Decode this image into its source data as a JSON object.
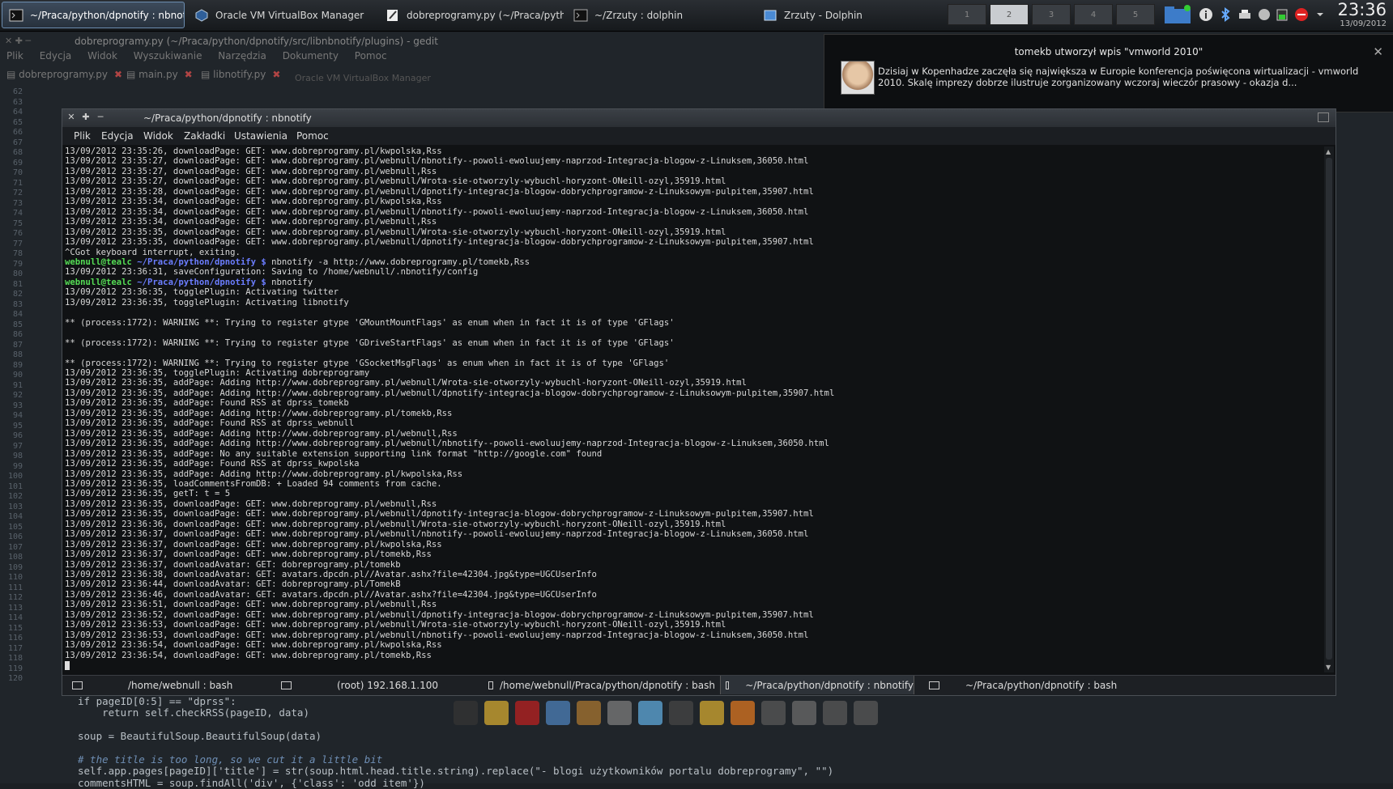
{
  "taskbar": {
    "tasks": [
      {
        "label": "~/Praca/python/dpnotify : nbnotify",
        "icon": "terminal-icon",
        "active": true
      },
      {
        "label": "Oracle VM VirtualBox Manager",
        "icon": "virtualbox-icon",
        "active": false
      },
      {
        "label": "dobreprogramy.py (~/Praca/python",
        "icon": "text-editor-icon",
        "active": false
      },
      {
        "label": "~/Zrzuty : dolphin",
        "icon": "terminal-icon",
        "active": false
      },
      {
        "label": "Zrzuty - Dolphin",
        "icon": "file-manager-icon",
        "active": false
      }
    ],
    "pager": [
      "1",
      "2",
      "3",
      "4",
      "5"
    ],
    "pager_current": 2,
    "clock_time": "23:36",
    "clock_date": "13/09/2012"
  },
  "gedit": {
    "title": "dobreprogramy.py (~/Praca/python/dpnotify/src/libnbnotify/plugins) - gedit",
    "menu": [
      "Plik",
      "Edycja",
      "Widok",
      "Wyszukiwanie",
      "Narzędzia",
      "Dokumenty",
      "Pomoc"
    ],
    "tabs": [
      "dobreprogramy.py",
      "main.py",
      "libnotify.py"
    ],
    "ghost_title": "Oracle VM VirtualBox Manager",
    "line_numbers": [
      "62",
      "63",
      "64",
      "65",
      "66",
      "67",
      "68",
      "69",
      "70",
      "71",
      "72",
      "73",
      "74",
      "75",
      "76",
      "77",
      "78",
      "79",
      "80",
      "81",
      "82",
      "83",
      "84",
      "85",
      "86",
      "87",
      "88",
      "89",
      "90",
      "91",
      "92",
      "93",
      "94",
      "95",
      "96",
      "97",
      "98",
      "99",
      "100",
      "101",
      "102",
      "103",
      "104",
      "105",
      "106",
      "107",
      "108",
      "109",
      "110",
      "111",
      "112",
      "113",
      "114",
      "115",
      "116",
      "117",
      "118",
      "119",
      "120"
    ],
    "code_lines": [
      "if pageID[0:5] == \"dprss\":",
      "    return self.checkRSS(pageID, data)",
      "",
      "soup = BeautifulSoup.BeautifulSoup(data)",
      "",
      "# the title is too long, so we cut it a little bit",
      "self.app.pages[pageID]['title'] = str(soup.html.head.title.string).replace(\"- blogi użytkowników portalu dobreprogramy\", \"\")",
      "commentsHTML = soup.findAll('div', {'class': 'odd item'})"
    ]
  },
  "notification": {
    "title": "tomekb utworzył wpis \"vmworld 2010\"",
    "body": "Dzisiaj w Kopenhadze zaczęła się największa w Europie konferencja poświęcona wirtualizacji - vmworld 2010. Skalę imprezy dobrze ilustruje zorganizowany wczoraj wieczór prasowy - okazja d..."
  },
  "konsole": {
    "title": "~/Praca/python/dpnotify : nbnotify",
    "menu": [
      "Plik",
      "Edycja",
      "Widok",
      "Zakładki",
      "Ustawienia",
      "Pomoc"
    ],
    "prompt_user": "webnull@tealc",
    "prompt_path": "~/Praca/python/dpnotify $",
    "lines": [
      {
        "t": "13/09/2012 23:35:26, downloadPage: GET: www.dobreprogramy.pl/kwpolska,Rss"
      },
      {
        "t": "13/09/2012 23:35:27, downloadPage: GET: www.dobreprogramy.pl/webnull/nbnotify--powoli-ewoluujemy-naprzod-Integracja-blogow-z-Linuksem,36050.html"
      },
      {
        "t": "13/09/2012 23:35:27, downloadPage: GET: www.dobreprogramy.pl/webnull,Rss"
      },
      {
        "t": "13/09/2012 23:35:27, downloadPage: GET: www.dobreprogramy.pl/webnull/Wrota-sie-otworzyly-wybuchl-horyzont-ONeill-ozyl,35919.html"
      },
      {
        "t": "13/09/2012 23:35:28, downloadPage: GET: www.dobreprogramy.pl/webnull/dpnotify-integracja-blogow-dobrychprogramow-z-Linuksowym-pulpitem,35907.html"
      },
      {
        "t": "13/09/2012 23:35:34, downloadPage: GET: www.dobreprogramy.pl/kwpolska,Rss"
      },
      {
        "t": "13/09/2012 23:35:34, downloadPage: GET: www.dobreprogramy.pl/webnull/nbnotify--powoli-ewoluujemy-naprzod-Integracja-blogow-z-Linuksem,36050.html"
      },
      {
        "t": "13/09/2012 23:35:34, downloadPage: GET: www.dobreprogramy.pl/webnull,Rss"
      },
      {
        "t": "13/09/2012 23:35:35, downloadPage: GET: www.dobreprogramy.pl/webnull/Wrota-sie-otworzyly-wybuchl-horyzont-ONeill-ozyl,35919.html"
      },
      {
        "t": "13/09/2012 23:35:35, downloadPage: GET: www.dobreprogramy.pl/webnull/dpnotify-integracja-blogow-dobrychprogramow-z-Linuksowym-pulpitem,35907.html"
      },
      {
        "t": "^CGot keyboard interrupt, exiting."
      },
      {
        "p": true,
        "t": " nbnotify -a http://www.dobreprogramy.pl/tomekb,Rss"
      },
      {
        "t": "13/09/2012 23:36:31, saveConfiguration: Saving to /home/webnull/.nbnotify/config"
      },
      {
        "p": true,
        "t": " nbnotify"
      },
      {
        "t": "13/09/2012 23:36:35, togglePlugin: Activating twitter"
      },
      {
        "t": "13/09/2012 23:36:35, togglePlugin: Activating libnotify"
      },
      {
        "t": ""
      },
      {
        "t": "** (process:1772): WARNING **: Trying to register gtype 'GMountMountFlags' as enum when in fact it is of type 'GFlags'"
      },
      {
        "t": ""
      },
      {
        "t": "** (process:1772): WARNING **: Trying to register gtype 'GDriveStartFlags' as enum when in fact it is of type 'GFlags'"
      },
      {
        "t": ""
      },
      {
        "t": "** (process:1772): WARNING **: Trying to register gtype 'GSocketMsgFlags' as enum when in fact it is of type 'GFlags'"
      },
      {
        "t": "13/09/2012 23:36:35, togglePlugin: Activating dobreprogramy"
      },
      {
        "t": "13/09/2012 23:36:35, addPage: Adding http://www.dobreprogramy.pl/webnull/Wrota-sie-otworzyly-wybuchl-horyzont-ONeill-ozyl,35919.html"
      },
      {
        "t": "13/09/2012 23:36:35, addPage: Adding http://www.dobreprogramy.pl/webnull/dpnotify-integracja-blogow-dobrychprogramow-z-Linuksowym-pulpitem,35907.html"
      },
      {
        "t": "13/09/2012 23:36:35, addPage: Found RSS at dprss_tomekb"
      },
      {
        "t": "13/09/2012 23:36:35, addPage: Adding http://www.dobreprogramy.pl/tomekb,Rss"
      },
      {
        "t": "13/09/2012 23:36:35, addPage: Found RSS at dprss_webnull"
      },
      {
        "t": "13/09/2012 23:36:35, addPage: Adding http://www.dobreprogramy.pl/webnull,Rss"
      },
      {
        "t": "13/09/2012 23:36:35, addPage: Adding http://www.dobreprogramy.pl/webnull/nbnotify--powoli-ewoluujemy-naprzod-Integracja-blogow-z-Linuksem,36050.html"
      },
      {
        "t": "13/09/2012 23:36:35, addPage: No any suitable extension supporting link format \"http://google.com\" found"
      },
      {
        "t": "13/09/2012 23:36:35, addPage: Found RSS at dprss_kwpolska"
      },
      {
        "t": "13/09/2012 23:36:35, addPage: Adding http://www.dobreprogramy.pl/kwpolska,Rss"
      },
      {
        "t": "13/09/2012 23:36:35, loadCommentsFromDB: + Loaded 94 comments from cache."
      },
      {
        "t": "13/09/2012 23:36:35, getT: t = 5"
      },
      {
        "t": "13/09/2012 23:36:35, downloadPage: GET: www.dobreprogramy.pl/webnull,Rss"
      },
      {
        "t": "13/09/2012 23:36:35, downloadPage: GET: www.dobreprogramy.pl/webnull/dpnotify-integracja-blogow-dobrychprogramow-z-Linuksowym-pulpitem,35907.html"
      },
      {
        "t": "13/09/2012 23:36:36, downloadPage: GET: www.dobreprogramy.pl/webnull/Wrota-sie-otworzyly-wybuchl-horyzont-ONeill-ozyl,35919.html"
      },
      {
        "t": "13/09/2012 23:36:37, downloadPage: GET: www.dobreprogramy.pl/webnull/nbnotify--powoli-ewoluujemy-naprzod-Integracja-blogow-z-Linuksem,36050.html"
      },
      {
        "t": "13/09/2012 23:36:37, downloadPage: GET: www.dobreprogramy.pl/kwpolska,Rss"
      },
      {
        "t": "13/09/2012 23:36:37, downloadPage: GET: www.dobreprogramy.pl/tomekb,Rss"
      },
      {
        "t": "13/09/2012 23:36:37, downloadAvatar: GET: dobreprogramy.pl/tomekb"
      },
      {
        "t": "13/09/2012 23:36:38, downloadAvatar: GET: avatars.dpcdn.pl//Avatar.ashx?file=42304.jpg&type=UGCUserInfo"
      },
      {
        "t": "13/09/2012 23:36:44, downloadAvatar: GET: dobreprogramy.pl/TomekB"
      },
      {
        "t": "13/09/2012 23:36:46, downloadAvatar: GET: avatars.dpcdn.pl//Avatar.ashx?file=42304.jpg&type=UGCUserInfo"
      },
      {
        "t": "13/09/2012 23:36:51, downloadPage: GET: www.dobreprogramy.pl/webnull,Rss"
      },
      {
        "t": "13/09/2012 23:36:52, downloadPage: GET: www.dobreprogramy.pl/webnull/dpnotify-integracja-blogow-dobrychprogramow-z-Linuksowym-pulpitem,35907.html"
      },
      {
        "t": "13/09/2012 23:36:53, downloadPage: GET: www.dobreprogramy.pl/webnull/Wrota-sie-otworzyly-wybuchl-horyzont-ONeill-ozyl,35919.html"
      },
      {
        "t": "13/09/2012 23:36:53, downloadPage: GET: www.dobreprogramy.pl/webnull/nbnotify--powoli-ewoluujemy-naprzod-Integracja-blogow-z-Linuksem,36050.html"
      },
      {
        "t": "13/09/2012 23:36:54, downloadPage: GET: www.dobreprogramy.pl/kwpolska,Rss"
      },
      {
        "t": "13/09/2012 23:36:54, downloadPage: GET: www.dobreprogramy.pl/tomekb,Rss"
      }
    ],
    "tabs": [
      {
        "label": "/home/webnull : bash",
        "active": false
      },
      {
        "label": "(root) 192.168.1.100",
        "active": false
      },
      {
        "label": "/home/webnull/Praca/python/dpnotify : bash",
        "active": false
      },
      {
        "label": "~/Praca/python/dpnotify : nbnotify",
        "active": true
      },
      {
        "label": "~/Praca/python/dpnotify : bash",
        "active": false
      }
    ]
  },
  "colors": {
    "prompt_user": "#55dd55",
    "prompt_path": "#6b7dff",
    "active_task_border": "#6c8db0"
  }
}
